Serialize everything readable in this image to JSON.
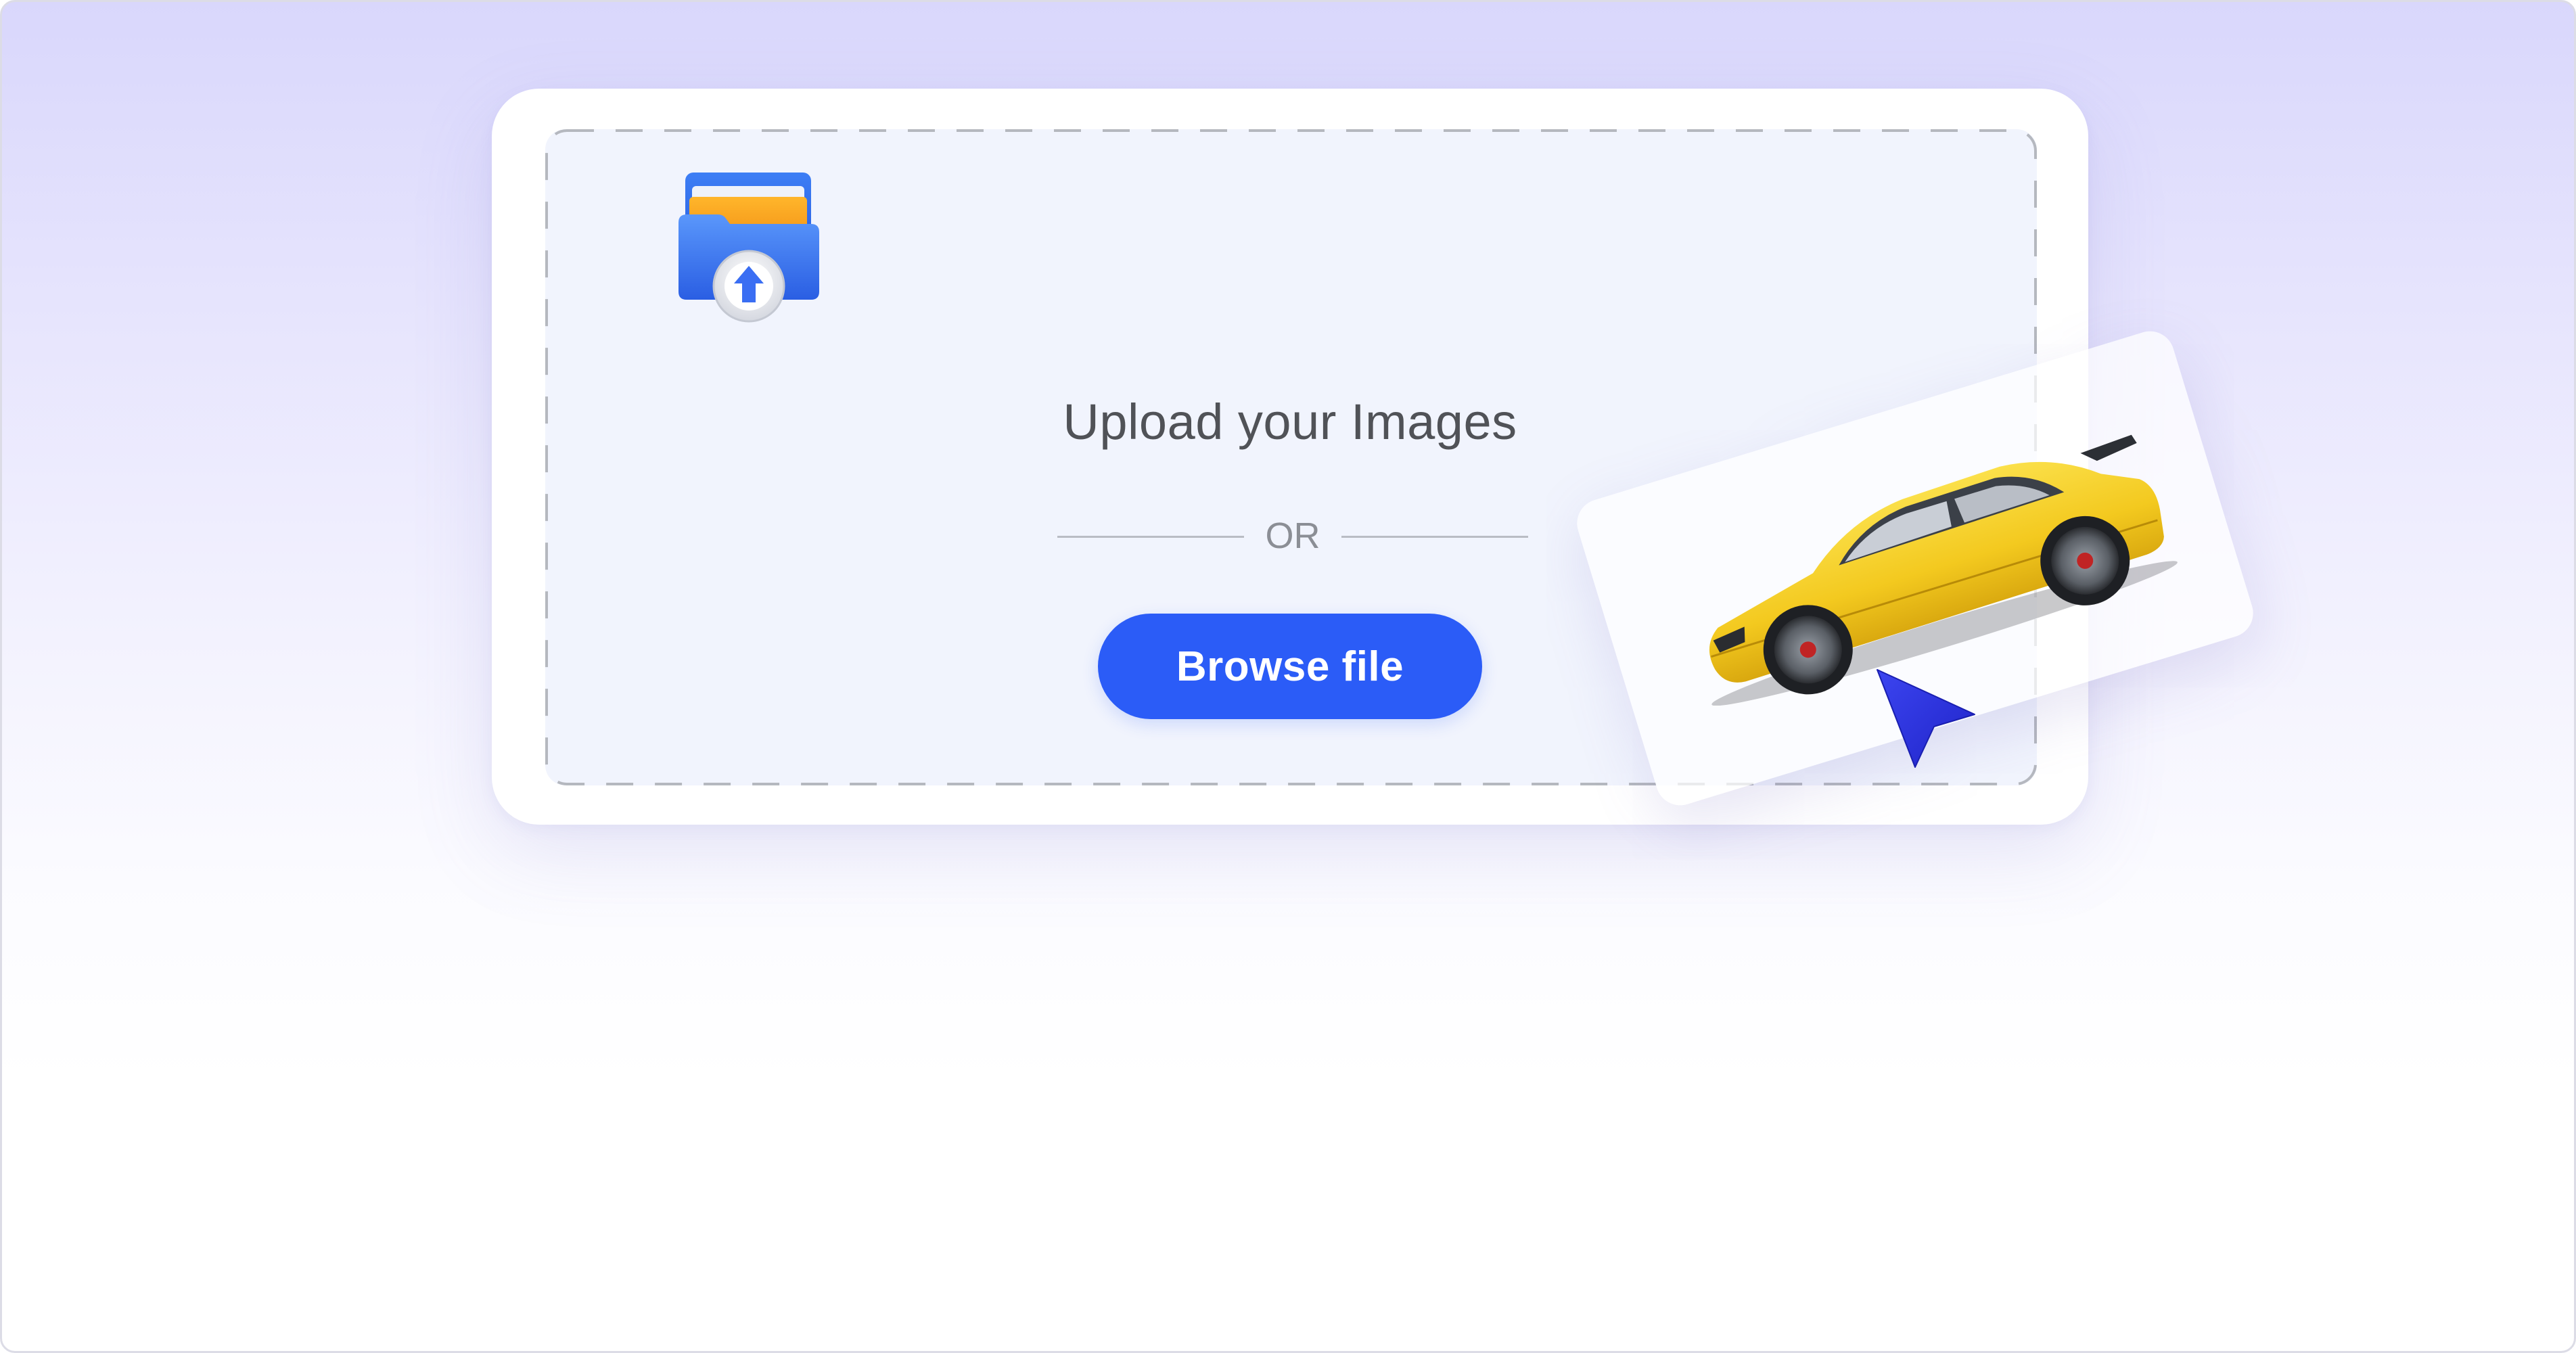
{
  "upload": {
    "title": "Upload your Images",
    "divider_text": "OR",
    "browse_button_label": "Browse file"
  },
  "icons": {
    "upload": "folder-upload-icon",
    "pointer": "cursor-arrow-icon"
  },
  "preview": {
    "image": "yellow-sports-car"
  },
  "colors": {
    "background_top": "#d9d7fc",
    "background_bottom": "#ffffff",
    "button": "#2b5cf7",
    "button_text": "#ffffff",
    "title_text": "#505257",
    "divider_text": "#8b8e95",
    "dropzone_fill": "#f1f4fd",
    "cursor": "#2d39e8",
    "car_body": "#f4d12a"
  }
}
